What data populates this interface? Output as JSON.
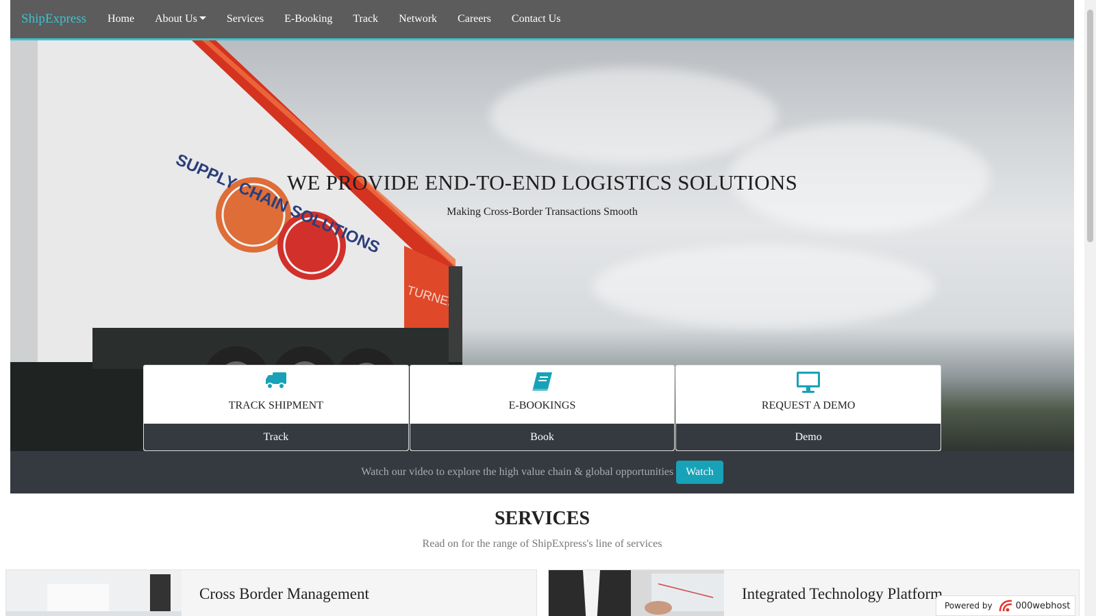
{
  "brand": "ShipExpress",
  "nav": {
    "items": [
      {
        "label": "Home",
        "dropdown": false
      },
      {
        "label": "About Us",
        "dropdown": true
      },
      {
        "label": "Services",
        "dropdown": false
      },
      {
        "label": "E-Booking",
        "dropdown": false
      },
      {
        "label": "Track",
        "dropdown": false
      },
      {
        "label": "Network",
        "dropdown": false
      },
      {
        "label": "Careers",
        "dropdown": false
      },
      {
        "label": "Contact Us",
        "dropdown": false
      }
    ]
  },
  "hero": {
    "title": "WE PROVIDE END-TO-END LOGISTICS SOLUTIONS",
    "subtitle": "Making Cross-Border Transactions Smooth",
    "truck_brand": "SUPPLY CHAIN SOLUTIONS",
    "truck_label": "TURNERS"
  },
  "cards": [
    {
      "icon": "truck-icon",
      "label": "TRACK SHIPMENT",
      "button": "Track"
    },
    {
      "icon": "book-icon",
      "label": "E-BOOKINGS",
      "button": "Book"
    },
    {
      "icon": "monitor-icon",
      "label": "REQUEST A DEMO",
      "button": "Demo"
    }
  ],
  "video": {
    "text": "Watch our video to explore the high value chain & global opportunities",
    "button": "Watch"
  },
  "services": {
    "title": "SERVICES",
    "subtitle": "Read on for the range of ShipExpress's line of services",
    "items": [
      {
        "title": "Cross Border Management"
      },
      {
        "title": "Integrated Technology Platform"
      }
    ]
  },
  "footer_badge": {
    "prefix": "Powered by",
    "name": "000webhost"
  },
  "colors": {
    "accent": "#37c6d3",
    "navbar": "#5c5c5c",
    "dark": "#343a40",
    "button": "#17a2b8"
  }
}
